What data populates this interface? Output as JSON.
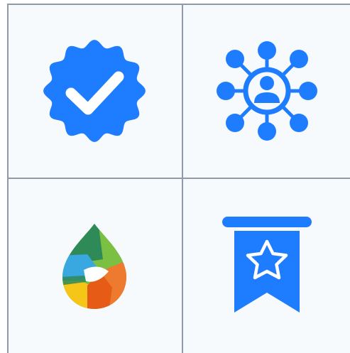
{
  "colors": {
    "background": "#f7fafc",
    "grid_line": "#8f99a8",
    "icon_blue": "#1e7cff",
    "white": "#ffffff",
    "drop_green": "#2e8b57",
    "drop_light_green": "#7cc043",
    "drop_blue": "#3aa8e0",
    "drop_yellow": "#f5c518",
    "drop_orange": "#ee7a30",
    "drop_dark_orange": "#e65c17"
  },
  "icons": [
    {
      "name": "verified-badge-icon",
      "color": "#1e7cff"
    },
    {
      "name": "user-network-icon",
      "color": "#1e7cff"
    },
    {
      "name": "colorful-drop-icon",
      "color": "multicolor"
    },
    {
      "name": "star-bookmark-ribbon-icon",
      "color": "#1e7cff"
    }
  ]
}
